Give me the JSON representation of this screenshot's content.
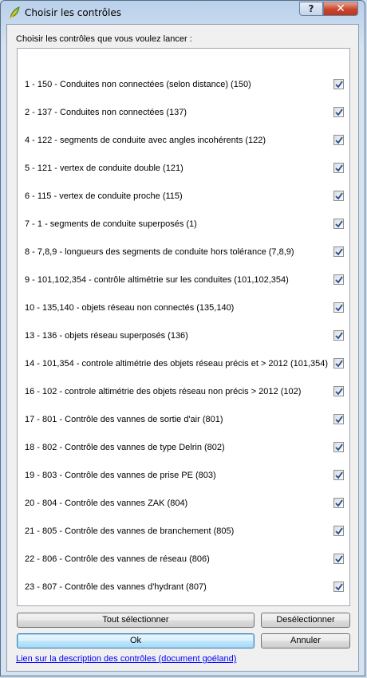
{
  "window": {
    "title": "Choisir les contrôles",
    "help_label": "?",
    "close_label": "✕"
  },
  "prompt": "Choisir les contrôles que vous voulez lancer :",
  "items": [
    {
      "label": "1 - 150 - Conduites non connectées (selon distance) (150)",
      "checked": true
    },
    {
      "label": "2 - 137 - Conduites non connectées (137)",
      "checked": true
    },
    {
      "label": "4 - 122 - segments de conduite avec angles incohérents (122)",
      "checked": true
    },
    {
      "label": "5 - 121 - vertex de conduite double (121)",
      "checked": true
    },
    {
      "label": "6 - 115 - vertex de conduite proche (115)",
      "checked": true
    },
    {
      "label": "7 - 1 - segments de conduite superposés (1)",
      "checked": true
    },
    {
      "label": "8 - 7,8,9 - longueurs des segments de conduite hors tolérance (7,8,9)",
      "checked": true
    },
    {
      "label": "9 - 101,102,354 - contrôle altimétrie sur les conduites (101,102,354)",
      "checked": true
    },
    {
      "label": "10 - 135,140 - objets réseau non connectés (135,140)",
      "checked": true
    },
    {
      "label": "13 - 136 - objets réseau superposés (136)",
      "checked": true
    },
    {
      "label": "14 - 101,354 - controle altimétrie des objets réseau précis et > 2012 (101,354)",
      "checked": true
    },
    {
      "label": "16 - 102 - controle altimétrie des objets réseau non précis > 2012 (102)",
      "checked": true
    },
    {
      "label": "17 - 801 - Contrôle des vannes de sortie d'air (801)",
      "checked": true
    },
    {
      "label": "18 - 802 - Contrôle des vannes de type Delrin (802)",
      "checked": true
    },
    {
      "label": "19 - 803 - Contrôle des vannes de prise PE (803)",
      "checked": true
    },
    {
      "label": "20 - 804 - Contrôle des vannes ZAK (804)",
      "checked": true
    },
    {
      "label": "21 - 805 - Contrôle des vannes de branchement (805)",
      "checked": true
    },
    {
      "label": "22 - 806 - Contrôle des vannes de réseau (806)",
      "checked": true
    },
    {
      "label": "23 - 807 - Contrôle des vannes d'hydrant (807)",
      "checked": true
    }
  ],
  "buttons": {
    "select_all": "Tout sélectionner",
    "deselect": "Desélectionner",
    "ok": "Ok",
    "cancel": "Annuler"
  },
  "link": "Lien sur la description des contrôles (document goéland)",
  "colors": {
    "link": "#0000ff",
    "check": "#1e4f8f",
    "close_button": "#c9452e"
  }
}
